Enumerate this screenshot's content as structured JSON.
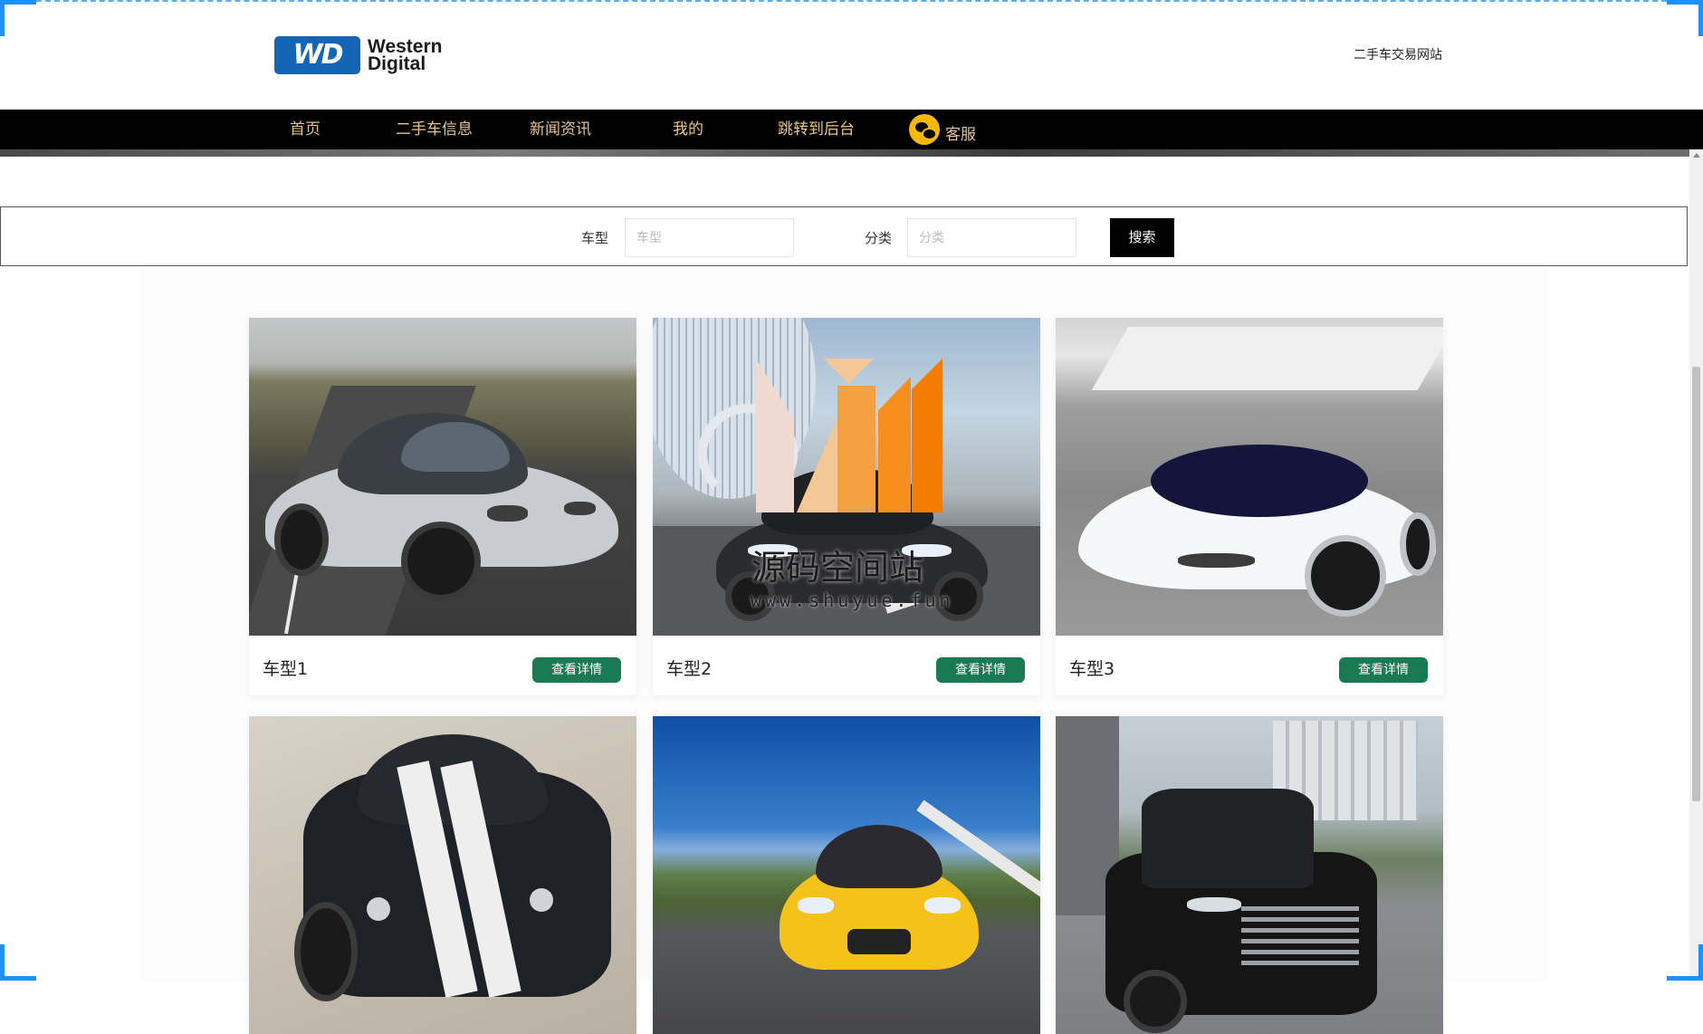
{
  "header": {
    "logo_badge": "WD",
    "logo_line1": "Western",
    "logo_line2": "Digital",
    "site_title": "二手车交易网站"
  },
  "nav": {
    "items": [
      {
        "label": "首页"
      },
      {
        "label": "二手车信息"
      },
      {
        "label": "新闻资讯"
      },
      {
        "label": "我的"
      },
      {
        "label": "跳转到后台"
      },
      {
        "label": "客服",
        "icon": "wechat-icon"
      }
    ]
  },
  "search": {
    "model_label": "车型",
    "model_placeholder": "车型",
    "category_label": "分类",
    "category_placeholder": "分类",
    "button_label": "搜索"
  },
  "cars": [
    {
      "title": "车型1",
      "button": "查看详情",
      "color": "#c9ccd0"
    },
    {
      "title": "车型2",
      "button": "查看详情",
      "color": "#2b2b2e"
    },
    {
      "title": "车型3",
      "button": "查看详情",
      "color": "#f4f6f8"
    },
    {
      "title": "",
      "button": "",
      "color": "#1e2126"
    },
    {
      "title": "",
      "button": "",
      "color": "#f5c21b"
    },
    {
      "title": "",
      "button": "",
      "color": "#151515"
    }
  ],
  "watermark": {
    "text": "源码空间站",
    "url": "www.shuyue.fun"
  },
  "colors": {
    "nav_bg": "#000000",
    "nav_text": "#e8c48a",
    "detail_button": "#1a7a52",
    "logo_blue": "#1565b7"
  }
}
